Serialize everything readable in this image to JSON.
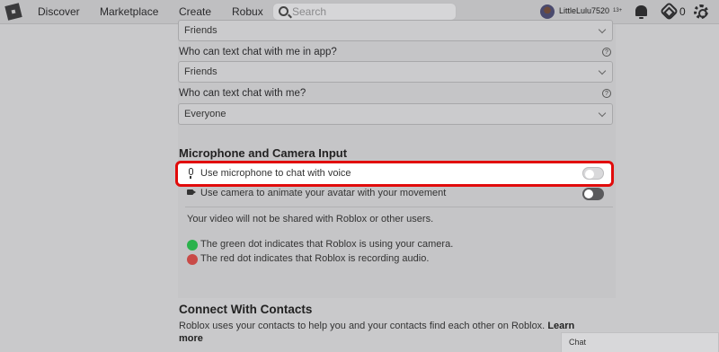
{
  "nav": {
    "items": [
      "Discover",
      "Marketplace",
      "Create",
      "Robux"
    ],
    "search_placeholder": "Search",
    "username": "LittleLulu7520",
    "age_badge": "13+",
    "robux_count": "0",
    "icons": [
      "roblox-logo-icon",
      "search-icon",
      "avatar",
      "bell-icon",
      "robux-icon",
      "gear-icon"
    ]
  },
  "privacy": {
    "top_select_value": "Friends",
    "question_app": "Who can text chat with me in app?",
    "select_app_value": "Friends",
    "question_chat": "Who can text chat with me?",
    "select_chat_value": "Everyone"
  },
  "media": {
    "heading": "Microphone and Camera Input",
    "mic_label": "Use microphone to chat with voice",
    "camera_label": "Use camera to animate your avatar with your movement",
    "video_note": "Your video will not be shared with Roblox or other users.",
    "green_dot_note": "The green dot indicates that Roblox is using your camera.",
    "red_dot_note": "The red dot indicates that Roblox is recording audio.",
    "colors": {
      "highlight": "#e10b0b",
      "green_dot": "#2bb24c",
      "red_dot": "#c94a47"
    },
    "mic_enabled": false,
    "camera_enabled": false
  },
  "contacts": {
    "heading": "Connect With Contacts",
    "text": "Roblox uses your contacts to help you and your contacts find each other on Roblox.",
    "learn_more": "Learn more"
  },
  "chat": {
    "label": "Chat"
  }
}
